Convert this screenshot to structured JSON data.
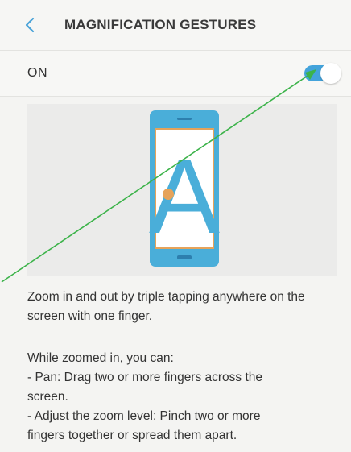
{
  "header": {
    "title": "MAGNIFICATION GESTURES",
    "back_icon": "chevron-left-icon"
  },
  "toggle": {
    "label": "ON",
    "state": true
  },
  "illustration": {
    "letter": "A",
    "phone_color": "#4aaed9",
    "screen_border_color": "#e6a35a"
  },
  "description": {
    "paragraph1": "Zoom in and out by triple tapping anywhere on the screen with one finger.",
    "paragraph2_lines": [
      "While zoomed in, you can:",
      "- Pan: Drag two or more fingers across the",
      "screen.",
      "- Adjust the zoom level: Pinch two or more",
      "fingers together or spread them apart."
    ]
  },
  "colors": {
    "accent": "#43a3db",
    "annotation_arrow": "#3cb34a"
  }
}
